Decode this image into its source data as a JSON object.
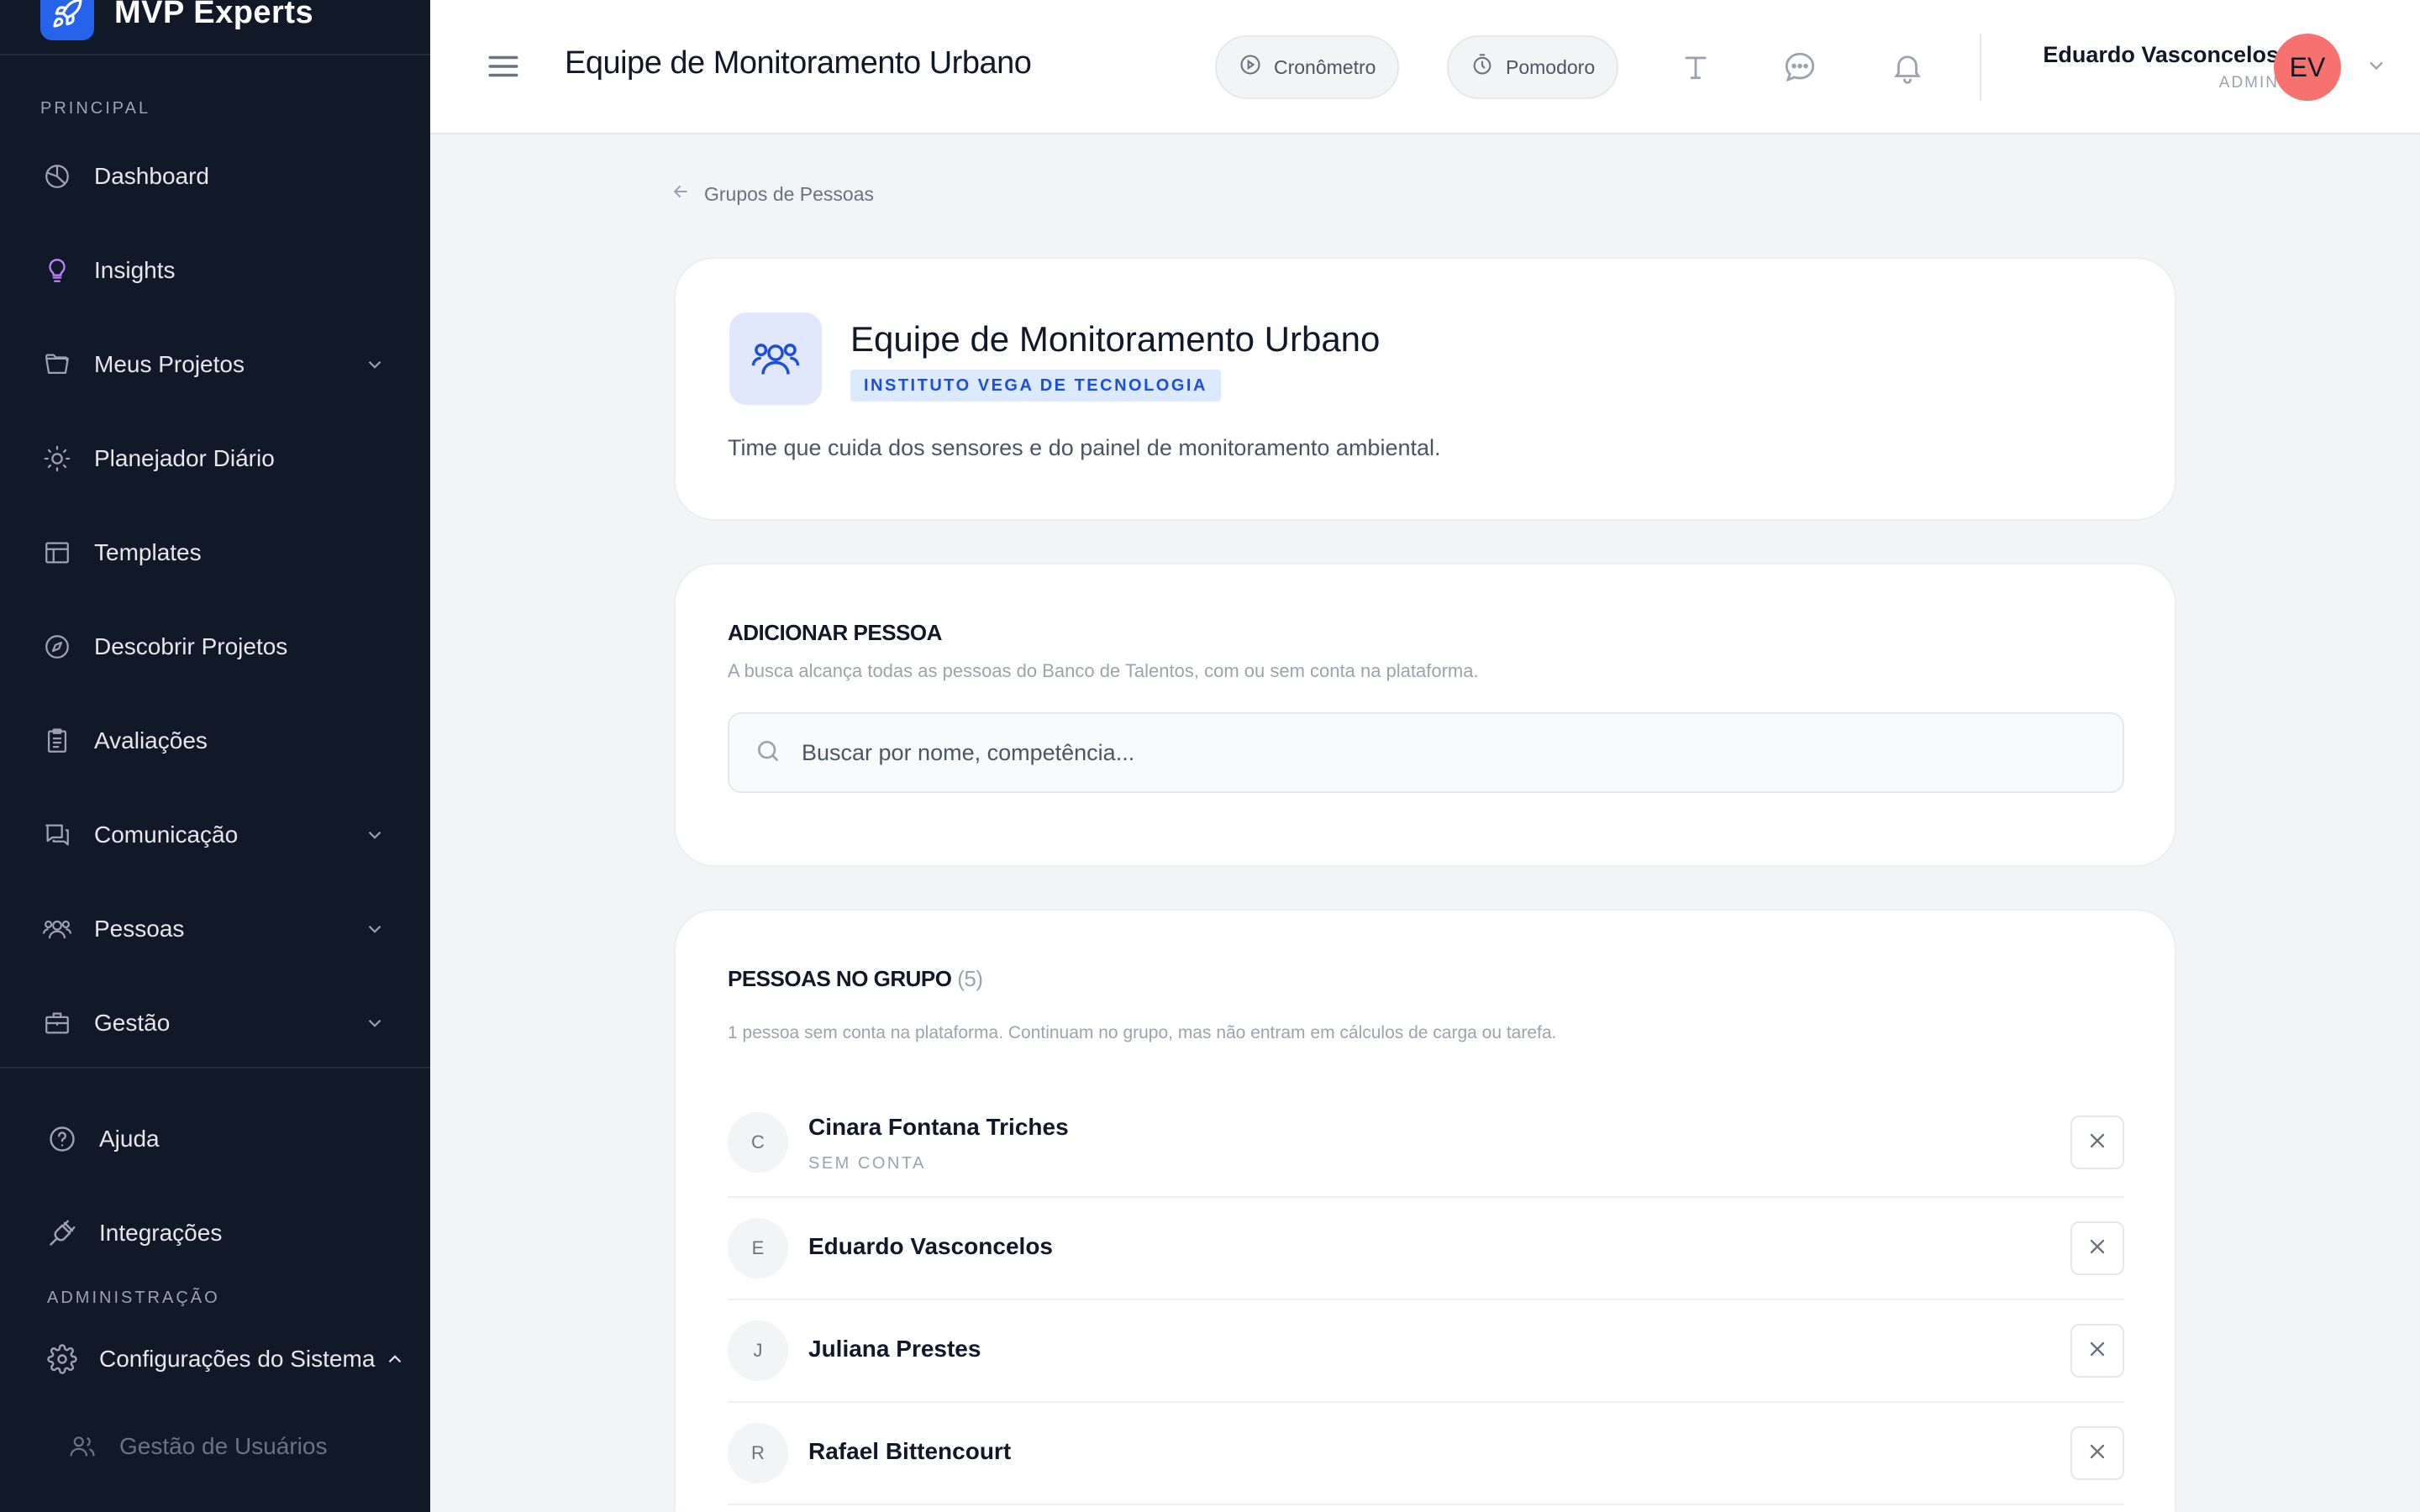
{
  "brand": {
    "name": "MVP Experts",
    "logo_icon": "rocket-icon",
    "color": "#2563eb"
  },
  "sidebar": {
    "section_main": "PRINCIPAL",
    "items": [
      {
        "label": "Dashboard",
        "icon": "pie-chart-icon"
      },
      {
        "label": "Insights",
        "icon": "lightbulb-icon"
      },
      {
        "label": "Meus Projetos",
        "icon": "folder-icon",
        "expandable": true
      },
      {
        "label": "Planejador Diário",
        "icon": "sun-icon"
      },
      {
        "label": "Templates",
        "icon": "layout-icon"
      },
      {
        "label": "Descobrir Projetos",
        "icon": "compass-icon"
      },
      {
        "label": "Avaliações",
        "icon": "clipboard-icon"
      },
      {
        "label": "Comunicação",
        "icon": "chat-icon",
        "expandable": true
      },
      {
        "label": "Pessoas",
        "icon": "users-icon",
        "expandable": true
      },
      {
        "label": "Gestão",
        "icon": "briefcase-icon",
        "expandable": true
      }
    ],
    "help_label": "Ajuda",
    "integrations_label": "Integrações",
    "section_admin": "ADMINISTRAÇÃO",
    "settings_label": "Configurações do Sistema",
    "user_mgmt_label": "Gestão de Usuários"
  },
  "header": {
    "title": "Equipe de Monitoramento Urbano",
    "stopwatch_label": "Cronômetro",
    "pomodoro_label": "Pomodoro",
    "user_name": "Eduardo Vasconcelos",
    "user_role": "ADMIN",
    "user_initials": "EV",
    "avatar_color": "#f87171"
  },
  "breadcrumb": {
    "back_label": "Grupos de Pessoas"
  },
  "group": {
    "title": "Equipe de Monitoramento Urbano",
    "organization": "INSTITUTO VEGA DE TECNOLOGIA",
    "description": "Time que cuida dos sensores e do painel de monitoramento ambiental."
  },
  "add_person": {
    "title": "ADICIONAR PESSOA",
    "subtitle": "A busca alcança todas as pessoas do Banco de Talentos, com ou sem conta na plataforma.",
    "search_placeholder": "Buscar por nome, competência..."
  },
  "members": {
    "title": "PESSOAS NO GRUPO",
    "count": "(5)",
    "note": "1 pessoa sem conta na plataforma. Continuam no grupo, mas não entram em cálculos de carga ou tarefa.",
    "people": [
      {
        "initial": "C",
        "name": "Cinara Fontana Triches",
        "status": "SEM CONTA"
      },
      {
        "initial": "E",
        "name": "Eduardo Vasconcelos",
        "status": ""
      },
      {
        "initial": "J",
        "name": "Juliana Prestes",
        "status": ""
      },
      {
        "initial": "R",
        "name": "Rafael Bittencourt",
        "status": ""
      }
    ]
  }
}
